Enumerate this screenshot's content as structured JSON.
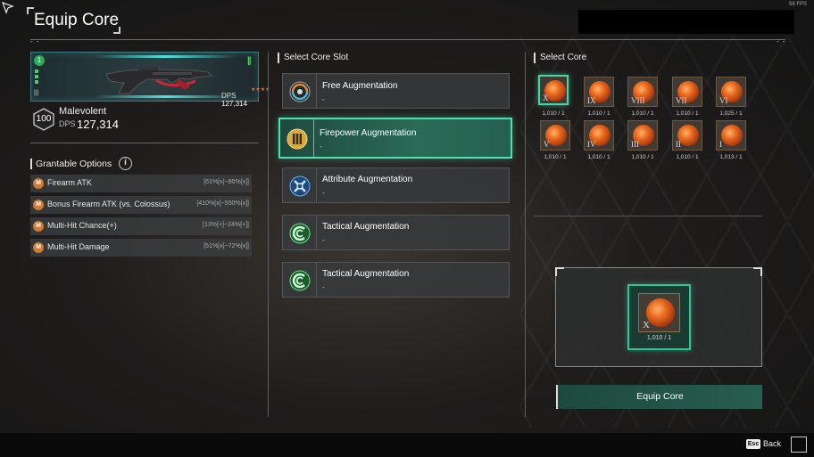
{
  "header": {
    "title": "Equip Core",
    "fps": "58 FPS",
    "dash_left": "- -",
    "dash_right": "- -"
  },
  "weapon": {
    "card_number": "1",
    "level_marker": "|||",
    "card_dps_label": "DPS",
    "card_dps_value": "127,314",
    "stars": "★★★★",
    "level": "100",
    "name": "Malevolent",
    "dps_label": "DPS",
    "dps_value": "127,314"
  },
  "grantable": {
    "title": "Grantable Options",
    "info_icon": "i",
    "options": [
      {
        "name": "Firearm ATK",
        "value": "[61%[x]~80%[x]]"
      },
      {
        "name": "Bonus Firearm ATK (vs. Colossus)",
        "value": "[410%[x]~550%[x]]"
      },
      {
        "name": "Multi-Hit Chance(+)",
        "value": "[13%[+]~24%[+]]"
      },
      {
        "name": "Multi-Hit Damage",
        "value": "[51%[x]~72%[x]]"
      }
    ]
  },
  "slots": {
    "title": "Select Core Slot",
    "items": [
      {
        "label": "Free Augmentation",
        "sub": "-",
        "icon": "free-augmentation-icon"
      },
      {
        "label": "Firepower Augmentation",
        "sub": "-",
        "icon": "firepower-augmentation-icon"
      },
      {
        "label": "Attribute Augmentation",
        "sub": "-",
        "icon": "attribute-augmentation-icon"
      },
      {
        "label": "Tactical Augmentation",
        "sub": "-",
        "icon": "tactical-augmentation-icon"
      },
      {
        "label": "Tactical Augmentation",
        "sub": "-",
        "icon": "tactical-augmentation-icon"
      }
    ]
  },
  "cores": {
    "title": "Select Core",
    "items": [
      {
        "roman": "X",
        "count": "1,010 / 1"
      },
      {
        "roman": "IX",
        "count": "1,010 / 1"
      },
      {
        "roman": "VIII",
        "count": "1,010 / 1"
      },
      {
        "roman": "VII",
        "count": "1,010 / 1"
      },
      {
        "roman": "VI",
        "count": "1,025 / 1"
      },
      {
        "roman": "V",
        "count": "1,010 / 1"
      },
      {
        "roman": "IV",
        "count": "1,010 / 1"
      },
      {
        "roman": "III",
        "count": "1,010 / 1"
      },
      {
        "roman": "II",
        "count": "1,010 / 1"
      },
      {
        "roman": "I",
        "count": "1,013 / 1"
      }
    ],
    "selected": {
      "roman": "X",
      "count": "1,010 / 1"
    }
  },
  "equip_button": "Equip Core",
  "footer": {
    "esc_key": "Esc",
    "back_label": "Back"
  },
  "colors": {
    "accent_green": "#4ee0b0",
    "orange": "#d27a2e",
    "cyan": "#4fe3e0"
  }
}
